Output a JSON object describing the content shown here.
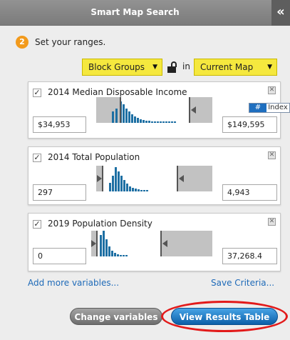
{
  "header": {
    "title": "Smart Map Search",
    "collapse_glyph": "«",
    "collapse_icon": "double-chevron-left-icon"
  },
  "step": {
    "number": "2",
    "text": "Set your ranges."
  },
  "geography": {
    "level": "Block Groups",
    "connector": "in",
    "extent": "Current Map",
    "lock_icon": "unlocked-padlock-icon"
  },
  "variables": [
    {
      "name": "2014 Median Disposable Income",
      "checked": true,
      "min": "$34,953",
      "max": "$149,595",
      "index_badge": {
        "hash": "#",
        "label": "Index"
      }
    },
    {
      "name": "2014 Total Population",
      "checked": true,
      "min": "297",
      "max": "4,943"
    },
    {
      "name": "2019 Population Density",
      "checked": true,
      "min": "0",
      "max": "37,268.4"
    }
  ],
  "links": {
    "add": "Add more variables...",
    "save": "Save Criteria..."
  },
  "buttons": {
    "change": "Change variables",
    "results": "View Results Table"
  },
  "colors": {
    "accent_yellow": "#f5e83e",
    "step_orange": "#f29a1c",
    "histogram_blue": "#1d6fa3",
    "highlight_red": "#e21a1a",
    "button_blue": "#0b5fa8"
  }
}
